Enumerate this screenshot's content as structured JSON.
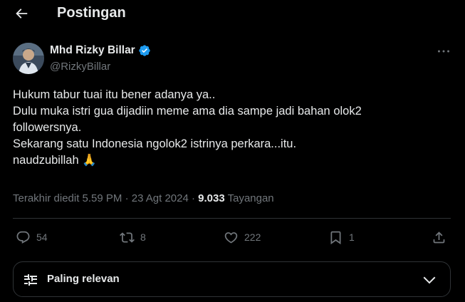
{
  "header": {
    "title": "Postingan",
    "back_icon": "arrow-left-icon"
  },
  "post": {
    "author_name": "Mhd Rizky Billar",
    "author_handle": "@RizkyBillar",
    "verified": true,
    "text_lines": [
      "Hukum tabur tuai itu bener adanya ya..",
      "Dulu muka istri gua dijadiin meme ama dia sampe jadi bahan olok2",
      "followersnya.",
      "Sekarang satu Indonesia ngolok2 istrinya perkara...itu.",
      "naudzubillah 🙏"
    ],
    "edited_label": "Terakhir diedit 5.59 PM · 23 Agt 2024 · ",
    "views_count": "9.033",
    "views_label": " Tayangan"
  },
  "actions": {
    "replies": "54",
    "reposts": "8",
    "likes": "222",
    "bookmarks": "1"
  },
  "sort": {
    "label": "Paling relevan"
  },
  "colors": {
    "background": "#000000",
    "text": "#e7e9ea",
    "muted": "#71767b",
    "border": "#2f3336",
    "verified_blue": "#1d9bf0"
  }
}
